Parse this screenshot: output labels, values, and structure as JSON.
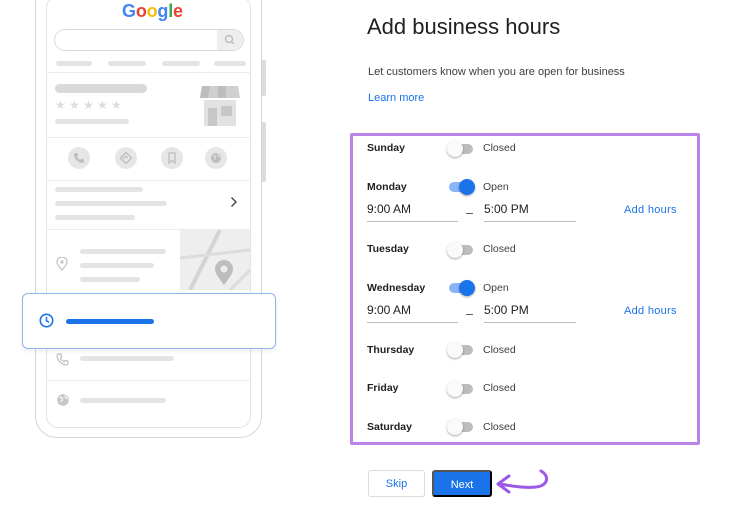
{
  "phone": {
    "logo_letters": [
      {
        "char": "G",
        "color": "#4285F4"
      },
      {
        "char": "o",
        "color": "#EA4335"
      },
      {
        "char": "o",
        "color": "#FBBC05"
      },
      {
        "char": "g",
        "color": "#4285F4"
      },
      {
        "char": "l",
        "color": "#34A853"
      },
      {
        "char": "e",
        "color": "#EA4335"
      }
    ],
    "rating_stars": "★",
    "action_icons": [
      "phone-icon",
      "directions-icon",
      "bookmark-icon",
      "website-icon"
    ],
    "highlight_card_icon": "clock-icon"
  },
  "form": {
    "title": "Add business hours",
    "subtitle": "Let customers know when you are open for business",
    "learn_more": "Learn more",
    "days": [
      {
        "name": "Sunday",
        "open": false,
        "status": "Closed"
      },
      {
        "name": "Monday",
        "open": true,
        "status": "Open",
        "from": "9:00 AM",
        "to": "5:00 PM",
        "add_hours": "Add hours"
      },
      {
        "name": "Tuesday",
        "open": false,
        "status": "Closed"
      },
      {
        "name": "Wednesday",
        "open": true,
        "status": "Open",
        "from": "9:00 AM",
        "to": "5:00 PM",
        "add_hours": "Add hours"
      },
      {
        "name": "Thursday",
        "open": false,
        "status": "Closed"
      },
      {
        "name": "Friday",
        "open": false,
        "status": "Closed"
      },
      {
        "name": "Saturday",
        "open": false,
        "status": "Closed"
      }
    ],
    "skip_label": "Skip",
    "next_label": "Next"
  },
  "colors": {
    "accent": "#1a73e8",
    "highlight_frame": "#b983ea",
    "arrow": "#9b59e6"
  }
}
